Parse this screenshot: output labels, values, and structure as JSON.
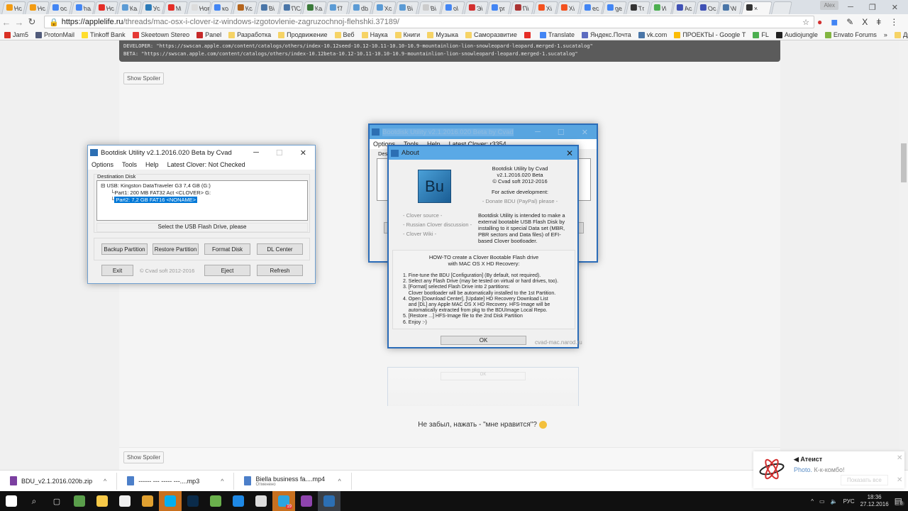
{
  "browser": {
    "tabs": [
      {
        "label": "Нс",
        "color": "#f39c12"
      },
      {
        "label": "Нс",
        "color": "#f39c12"
      },
      {
        "label": "ос",
        "color": "#4285f4"
      },
      {
        "label": "ha",
        "color": "#4285f4"
      },
      {
        "label": "Нс",
        "color": "#e52d27"
      },
      {
        "label": "Ка",
        "color": "#5b9bd5"
      },
      {
        "label": "Ус",
        "color": "#2a7ab8"
      },
      {
        "label": "М",
        "color": "#e52d27"
      },
      {
        "label": "Новая",
        "color": "#ddd"
      },
      {
        "label": "ко",
        "color": "#4285f4"
      },
      {
        "label": "Кс",
        "color": "#b5651d"
      },
      {
        "label": "Ві",
        "color": "#4a76a8"
      },
      {
        "label": "ПС",
        "color": "#4a76a8"
      },
      {
        "label": "Ка",
        "color": "#3a7a3a"
      },
      {
        "label": "f7",
        "color": "#5b9bd5"
      },
      {
        "label": "db",
        "color": "#5b9bd5"
      },
      {
        "label": "Хс",
        "color": "#5b9bd5"
      },
      {
        "label": "Ві",
        "color": "#5b9bd5"
      },
      {
        "label": "Ві",
        "color": "#ccc"
      },
      {
        "label": "ol",
        "color": "#4285f4"
      },
      {
        "label": "Эі",
        "color": "#d32f2f"
      },
      {
        "label": "pr",
        "color": "#4285f4"
      },
      {
        "label": "Пі",
        "color": "#a33"
      },
      {
        "label": "Xi",
        "color": "#f4511e"
      },
      {
        "label": "Xi",
        "color": "#f4511e"
      },
      {
        "label": "ес",
        "color": "#4285f4"
      },
      {
        "label": "ge",
        "color": "#4285f4"
      },
      {
        "label": "Тг",
        "color": "#333"
      },
      {
        "label": "И",
        "color": "#4caf50"
      },
      {
        "label": "Ас",
        "color": "#3f51b5"
      },
      {
        "label": "Ос",
        "color": "#3f51b5"
      },
      {
        "label": "W",
        "color": "#4a76a8"
      },
      {
        "label": "×",
        "color": "#333",
        "active": true
      }
    ],
    "user": "Alex",
    "url_host": "https://applelife.ru",
    "url_path": "/threads/mac-osx-i-clover-iz-windows-izgotovlenie-zagruzochnoj-flehshki.37189/",
    "bookmarks": [
      {
        "label": "Jam5",
        "color": "#d93025"
      },
      {
        "label": "ProtonMail",
        "color": "#505a7a"
      },
      {
        "label": "Tinkoff Bank",
        "color": "#ffdd2d"
      },
      {
        "label": "Skeetown Stereo",
        "color": "#e53935"
      },
      {
        "label": "Panel",
        "color": "#c62828"
      },
      {
        "label": "Разработка",
        "color": "#f6d365"
      },
      {
        "label": "Продвижение",
        "color": "#f6d365"
      },
      {
        "label": "Веб",
        "color": "#f6d365"
      },
      {
        "label": "Наука",
        "color": "#f6d365"
      },
      {
        "label": "Книги",
        "color": "#f6d365"
      },
      {
        "label": "Музыка",
        "color": "#f6d365"
      },
      {
        "label": "Саморазвитие",
        "color": "#f6d365"
      },
      {
        "label": "",
        "color": "#e52d27"
      },
      {
        "label": "Translate",
        "color": "#4285f4"
      },
      {
        "label": "Яндекс.Почта",
        "color": "#5c6bc0"
      },
      {
        "label": "vk.com",
        "color": "#4a76a8"
      },
      {
        "label": "ПРОЕКТЫ - Google Т",
        "color": "#fbbc05"
      },
      {
        "label": "FL",
        "color": "#4caf50"
      },
      {
        "label": "Audiojungle",
        "color": "#222"
      },
      {
        "label": "Envato Forums",
        "color": "#82b541"
      }
    ],
    "bookmarks_more": "»",
    "other_bookmarks": "Другие закладки"
  },
  "page": {
    "code_lines": [
      "DEVELOPER: \"https://swscan.apple.com/content/catalogs/others/index-10.12seed-10.12-10.11-10.10-10.9-mountainlion-lion-snowleopard-leopard.merged-1.sucatalog\"",
      "BETA: \"https://swscan.apple.com/content/catalogs/others/index-10.12beta-10.12-10.11-10.10-10.9-mountainlion-lion-snowleopard-leopard.merged-1.sucatalog\""
    ],
    "spoiler_label": "Show Spoiler",
    "like_prompt": "Не забыл, нажать - \"мне нравится\"?",
    "watermark": "cvad-mac.narod.ru"
  },
  "bdu1": {
    "title": "Bootdisk Utility v2.1.2016.020 Beta by Cvad",
    "menu": [
      "Options",
      "Tools",
      "Help",
      "Latest Clover: Not Checked"
    ],
    "group_label": "Destination Disk",
    "tree": [
      "USB: Kingston DataTraveler G3 7,4 GB (G:)",
      "Part1: 200 MB FAT32 Act <CLOVER> G:",
      "Part2: 7,2 GB FAT16 <NONAME>"
    ],
    "status": "Select the USB Flash Drive, please",
    "buttons": [
      "Backup Partition",
      "Restore Partition",
      "Format Disk",
      "DL Center"
    ],
    "exit": "Exit",
    "copyright": "© Cvad soft 2012-2016",
    "eject": "Eject",
    "refresh": "Refresh"
  },
  "bdu2": {
    "title": "Bootdisk Utility v2.1.2016.020 Beta by Cvad",
    "menu": [
      "Options",
      "Tools",
      "Help",
      "Latest Clover: r3354"
    ],
    "group_label": "Dest"
  },
  "about": {
    "title": "About",
    "logo": "Bu",
    "info": [
      "Bootdisk Utility by Cvad",
      "v2.1.2016.020 Beta",
      "© Cvad soft 2012-2016"
    ],
    "dev": "For active development:",
    "donate": "- Donate BDU (PayPal) please -",
    "links": [
      "- Clover source -",
      "- Russian Clover discussion -",
      "- Clover Wiki -"
    ],
    "desc": "Bootdisk Utility is intended to make a external bootable USB Flash Disk by installing to it special Data set (MBR, PBR sectors and Data files) of EFI-based Clover bootloader.",
    "howto_title": [
      "HOW-TO create a Clover Bootable Flash drive",
      "with MAC OS X HD Recovery:"
    ],
    "steps": [
      "1. Fine-tune the BDU [Configuration] (By default, not required).",
      "2. Select any Flash Drive (may be tested on virtual or hard drives, too).",
      "3. [Format] selected Flash Drive into 2 partitions:",
      "    Clover bootloader will be automatically installed to the 1st Partition.",
      "4. Open [Download Center], [Update] HD Recovery Download List",
      "    and [DL] any Apple MAC OS X HD Recovery. HFS-Image will be",
      "    automatically extracted from pkg to the BDUImage Local Repo.",
      "5. [Restore ...] HFS-Image file to the 2nd Disk Partition",
      "6. Enjoy :-)"
    ],
    "ok": "OK"
  },
  "downloads": [
    {
      "name": "BDU_v2.1.2016.020b.zip",
      "sub": ""
    },
    {
      "name": "------ --- ----- ---....mp3",
      "sub": ""
    },
    {
      "name": "Biella business fa....mp4",
      "sub": "Отменено"
    }
  ],
  "notification": {
    "title": "Атеист",
    "link": "Photo.",
    "text": "К-к-комбо!",
    "show_all": "Показать все"
  },
  "taskbar": {
    "apps": [
      {
        "name": "windows",
        "color": "#fff"
      },
      {
        "name": "search",
        "color": "transparent"
      },
      {
        "name": "task-view",
        "color": "transparent"
      },
      {
        "name": "vpn",
        "color": "#5a9e4b"
      },
      {
        "name": "explorer",
        "color": "#f7c948"
      },
      {
        "name": "store",
        "color": "#eee"
      },
      {
        "name": "chrome",
        "color": "#e0a030"
      },
      {
        "name": "skype",
        "color": "#00aff0"
      },
      {
        "name": "photoshop",
        "color": "#0a2b4a"
      },
      {
        "name": "utorrent",
        "color": "#6ab04c"
      },
      {
        "name": "edge",
        "color": "#1e88e5"
      },
      {
        "name": "settings",
        "color": "#ddd"
      },
      {
        "name": "telegram",
        "color": "#2ca5e0"
      },
      {
        "name": "winrar",
        "color": "#8e44ad"
      },
      {
        "name": "bdu",
        "color": "#2c6fb3"
      }
    ],
    "telegram_badge": "19",
    "lang": "РУС",
    "time": "18:36",
    "date": "27.12.2016",
    "notif_count": "8"
  }
}
